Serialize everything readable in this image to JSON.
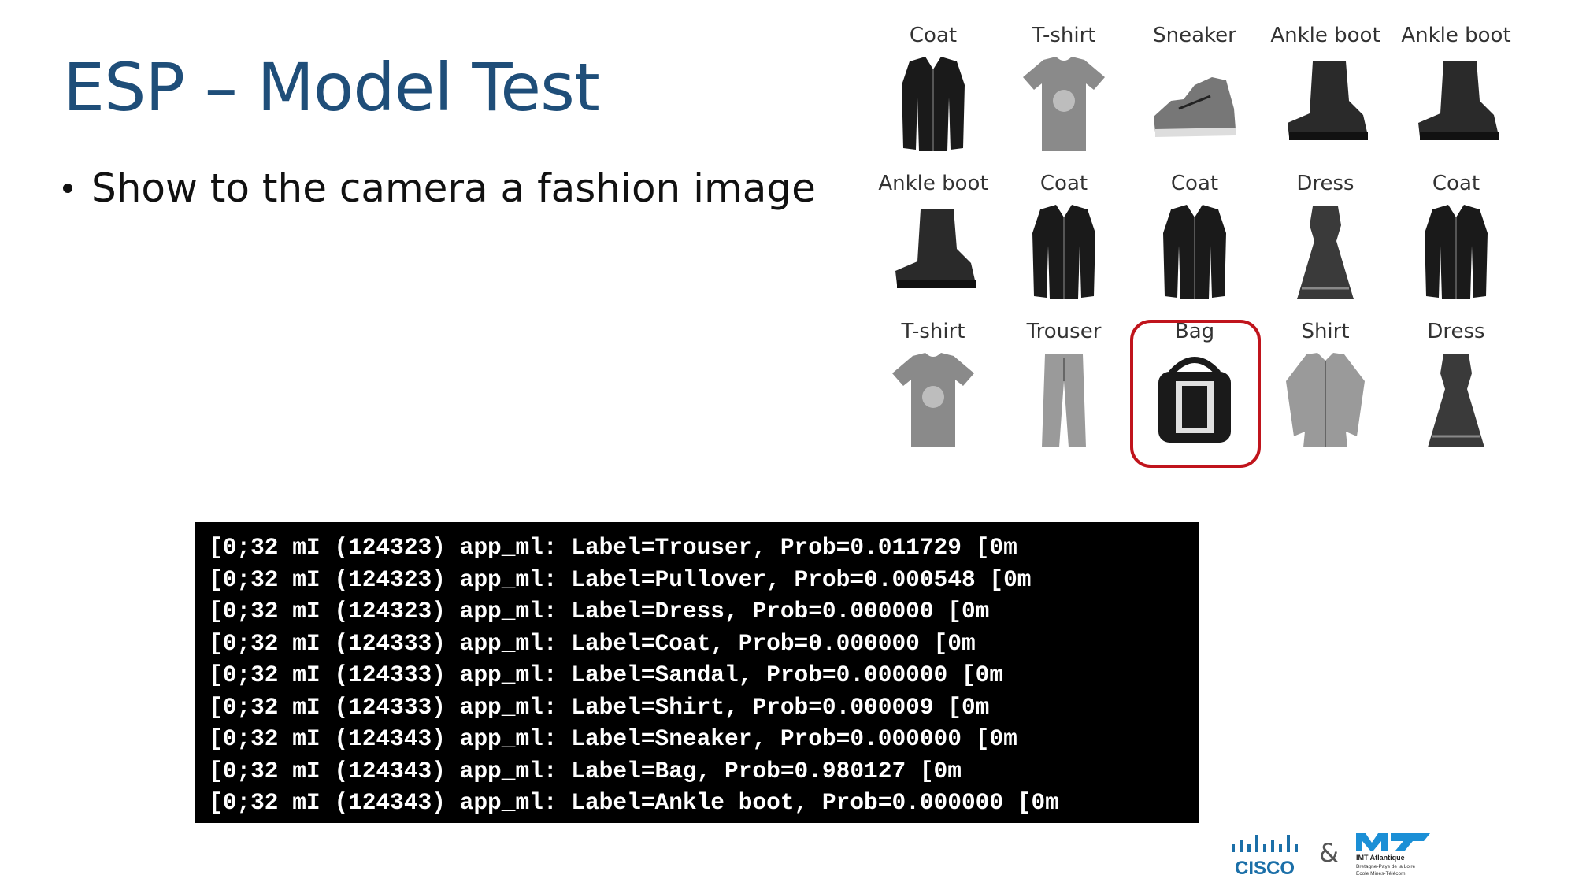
{
  "slide": {
    "title": "ESP – Model Test",
    "bullet": "Show to the camera a fashion image"
  },
  "grid": {
    "items": [
      {
        "label": "Coat",
        "icon": "coat-icon"
      },
      {
        "label": "T-shirt",
        "icon": "tshirt-icon"
      },
      {
        "label": "Sneaker",
        "icon": "sneaker-icon"
      },
      {
        "label": "Ankle boot",
        "icon": "ankle-boot-icon"
      },
      {
        "label": "Ankle boot",
        "icon": "ankle-boot-icon"
      },
      {
        "label": "Ankle boot",
        "icon": "ankle-boot-icon"
      },
      {
        "label": "Coat",
        "icon": "coat-icon"
      },
      {
        "label": "Coat",
        "icon": "coat-icon"
      },
      {
        "label": "Dress",
        "icon": "dress-icon"
      },
      {
        "label": "Coat",
        "icon": "coat-icon"
      },
      {
        "label": "T-shirt",
        "icon": "tshirt-icon"
      },
      {
        "label": "Trouser",
        "icon": "trouser-icon"
      },
      {
        "label": "Bag",
        "icon": "bag-icon"
      },
      {
        "label": "Shirt",
        "icon": "shirt-icon"
      },
      {
        "label": "Dress",
        "icon": "dress-icon"
      }
    ],
    "highlight_color": "#c0141c"
  },
  "console": {
    "lines": [
      "[0;32 mI (124323) app_ml: Label=Trouser, Prob=0.011729 [0m",
      "[0;32 mI (124323) app_ml: Label=Pullover, Prob=0.000548 [0m",
      "[0;32 mI (124323) app_ml: Label=Dress, Prob=0.000000 [0m",
      "[0;32 mI (124333) app_ml: Label=Coat, Prob=0.000000 [0m",
      "[0;32 mI (124333) app_ml: Label=Sandal, Prob=0.000000 [0m",
      "[0;32 mI (124333) app_ml: Label=Shirt, Prob=0.000009 [0m",
      "[0;32 mI (124343) app_ml: Label=Sneaker, Prob=0.000000 [0m",
      "[0;32 mI (124343) app_ml: Label=Bag, Prob=0.980127 [0m",
      "[0;32 mI (124343) app_ml: Label=Ankle boot, Prob=0.000000 [0m"
    ]
  },
  "footer": {
    "cisco_text": "CISCO",
    "ampersand": "&",
    "imt_text": "IMT Atlantique",
    "imt_sub1": "Bretagne-Pays de la Loire",
    "imt_sub2": "École Mines-Télécom"
  },
  "colors": {
    "title": "#1f4e79",
    "console_bg": "#000000",
    "highlight": "#c0141c",
    "cisco": "#1b6fa8",
    "imt": "#1b8fd6"
  }
}
